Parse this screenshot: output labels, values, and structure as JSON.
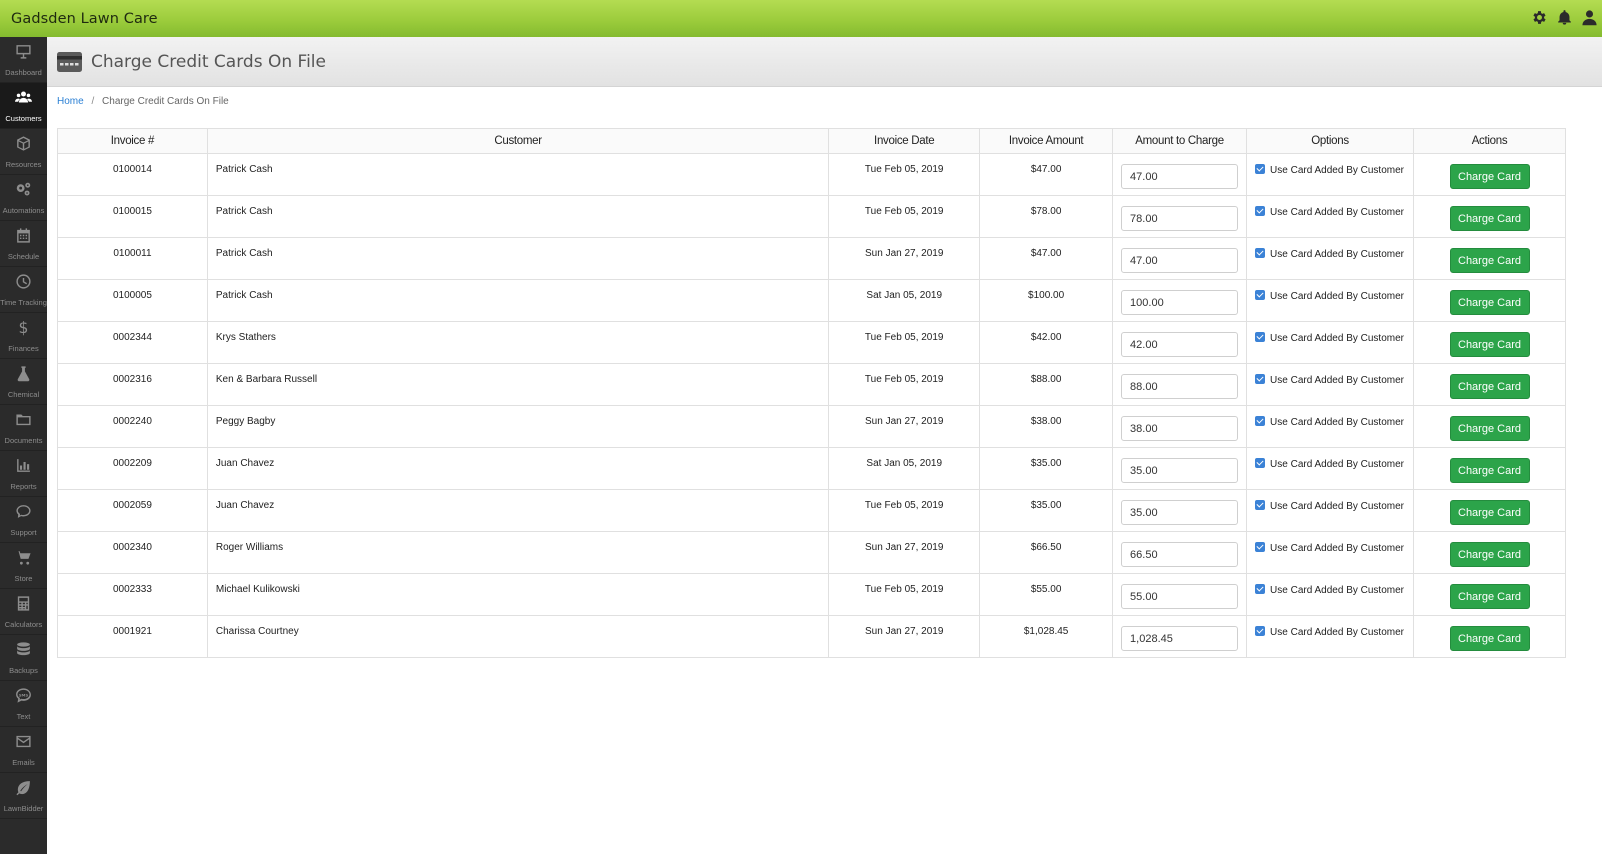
{
  "app": {
    "title": "Gadsden Lawn Care"
  },
  "topbar": {
    "icons": [
      "gear-icon",
      "bell-icon",
      "user-icon"
    ]
  },
  "sidebar": {
    "items": [
      {
        "label": "Dashboard",
        "icon": "monitor-icon",
        "active": false
      },
      {
        "label": "Customers",
        "icon": "users-icon",
        "active": true
      },
      {
        "label": "Resources",
        "icon": "cube-icon",
        "active": false
      },
      {
        "label": "Automations",
        "icon": "cogs-icon",
        "active": false
      },
      {
        "label": "Schedule",
        "icon": "calendar-icon",
        "active": false
      },
      {
        "label": "Time Tracking",
        "icon": "clock-icon",
        "active": false
      },
      {
        "label": "Finances",
        "icon": "dollar-icon",
        "active": false
      },
      {
        "label": "Chemical",
        "icon": "flask-icon",
        "active": false
      },
      {
        "label": "Documents",
        "icon": "folder-icon",
        "active": false
      },
      {
        "label": "Reports",
        "icon": "bar-chart-icon",
        "active": false
      },
      {
        "label": "Support",
        "icon": "chat-icon",
        "active": false
      },
      {
        "label": "Store",
        "icon": "cart-icon",
        "active": false
      },
      {
        "label": "Calculators",
        "icon": "calculator-icon",
        "active": false
      },
      {
        "label": "Backups",
        "icon": "database-icon",
        "active": false
      },
      {
        "label": "Text",
        "icon": "sms-icon",
        "active": false
      },
      {
        "label": "Emails",
        "icon": "envelope-icon",
        "active": false
      },
      {
        "label": "LawnBidder",
        "icon": "leaf-icon",
        "active": false
      }
    ]
  },
  "header": {
    "title": "Charge Credit Cards On File",
    "icon": "credit-card-icon"
  },
  "breadcrumb": {
    "home": "Home",
    "separator": "/",
    "current": "Charge Credit Cards On File"
  },
  "table": {
    "columns": [
      "Invoice #",
      "Customer",
      "Invoice Date",
      "Invoice Amount",
      "Amount to Charge",
      "Options",
      "Actions"
    ],
    "option_label": "Use Card Added By Customer",
    "action_label": "Charge Card",
    "rows": [
      {
        "invoice": "0100014",
        "customer": "Patrick Cash",
        "date": "Tue Feb 05, 2019",
        "amount": "$47.00",
        "charge": "47.00",
        "use_card": true
      },
      {
        "invoice": "0100015",
        "customer": "Patrick Cash",
        "date": "Tue Feb 05, 2019",
        "amount": "$78.00",
        "charge": "78.00",
        "use_card": true
      },
      {
        "invoice": "0100011",
        "customer": "Patrick Cash",
        "date": "Sun Jan 27, 2019",
        "amount": "$47.00",
        "charge": "47.00",
        "use_card": true
      },
      {
        "invoice": "0100005",
        "customer": "Patrick Cash",
        "date": "Sat Jan 05, 2019",
        "amount": "$100.00",
        "charge": "100.00",
        "use_card": true
      },
      {
        "invoice": "0002344",
        "customer": "Krys Stathers",
        "date": "Tue Feb 05, 2019",
        "amount": "$42.00",
        "charge": "42.00",
        "use_card": true
      },
      {
        "invoice": "0002316",
        "customer": "Ken & Barbara Russell",
        "date": "Tue Feb 05, 2019",
        "amount": "$88.00",
        "charge": "88.00",
        "use_card": true
      },
      {
        "invoice": "0002240",
        "customer": "Peggy Bagby",
        "date": "Sun Jan 27, 2019",
        "amount": "$38.00",
        "charge": "38.00",
        "use_card": true
      },
      {
        "invoice": "0002209",
        "customer": "Juan Chavez",
        "date": "Sat Jan 05, 2019",
        "amount": "$35.00",
        "charge": "35.00",
        "use_card": true
      },
      {
        "invoice": "0002059",
        "customer": "Juan Chavez",
        "date": "Tue Feb 05, 2019",
        "amount": "$35.00",
        "charge": "35.00",
        "use_card": true
      },
      {
        "invoice": "0002340",
        "customer": "Roger Williams",
        "date": "Sun Jan 27, 2019",
        "amount": "$66.50",
        "charge": "66.50",
        "use_card": true
      },
      {
        "invoice": "0002333",
        "customer": "Michael Kulikowski",
        "date": "Tue Feb 05, 2019",
        "amount": "$55.00",
        "charge": "55.00",
        "use_card": true
      },
      {
        "invoice": "0001921",
        "customer": "Charissa Courtney",
        "date": "Sun Jan 27, 2019",
        "amount": "$1,028.45",
        "charge": "1,028.45",
        "use_card": true
      }
    ]
  },
  "colors": {
    "topbar_green": "#9ccc3c",
    "sidebar_bg": "#2b2b2b",
    "button_green": "#2ca44a",
    "link_blue": "#2a7fd4",
    "checkbox_blue": "#3b82d6"
  }
}
